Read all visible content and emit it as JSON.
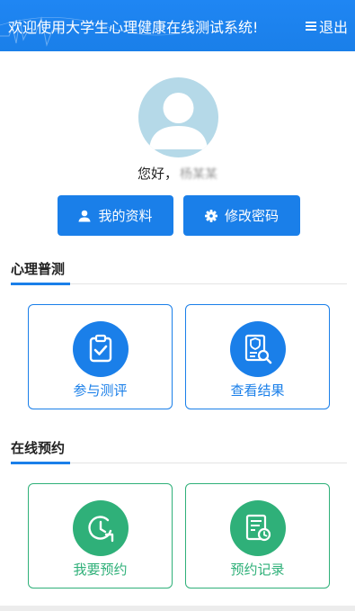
{
  "header": {
    "title": "欢迎使用大学生心理健康在线测试系统!",
    "logout_label": "退出",
    "menu_icon": "menu-icon",
    "background_color": "#1a7fe9"
  },
  "user": {
    "greeting": "您好，",
    "username": "杨某某"
  },
  "actions": {
    "profile_label": "我的资料",
    "password_label": "修改密码"
  },
  "sections": [
    {
      "title": "心理普测",
      "accent_color": "#1a7fe9",
      "cards": [
        {
          "label": "参与测评",
          "icon": "clipboard-check-icon"
        },
        {
          "label": "查看结果",
          "icon": "report-search-icon"
        }
      ]
    },
    {
      "title": "在线预约",
      "accent_color": "#2fb079",
      "cards": [
        {
          "label": "我要预约",
          "icon": "clock-icon"
        },
        {
          "label": "预约记录",
          "icon": "record-clock-icon"
        }
      ]
    }
  ]
}
